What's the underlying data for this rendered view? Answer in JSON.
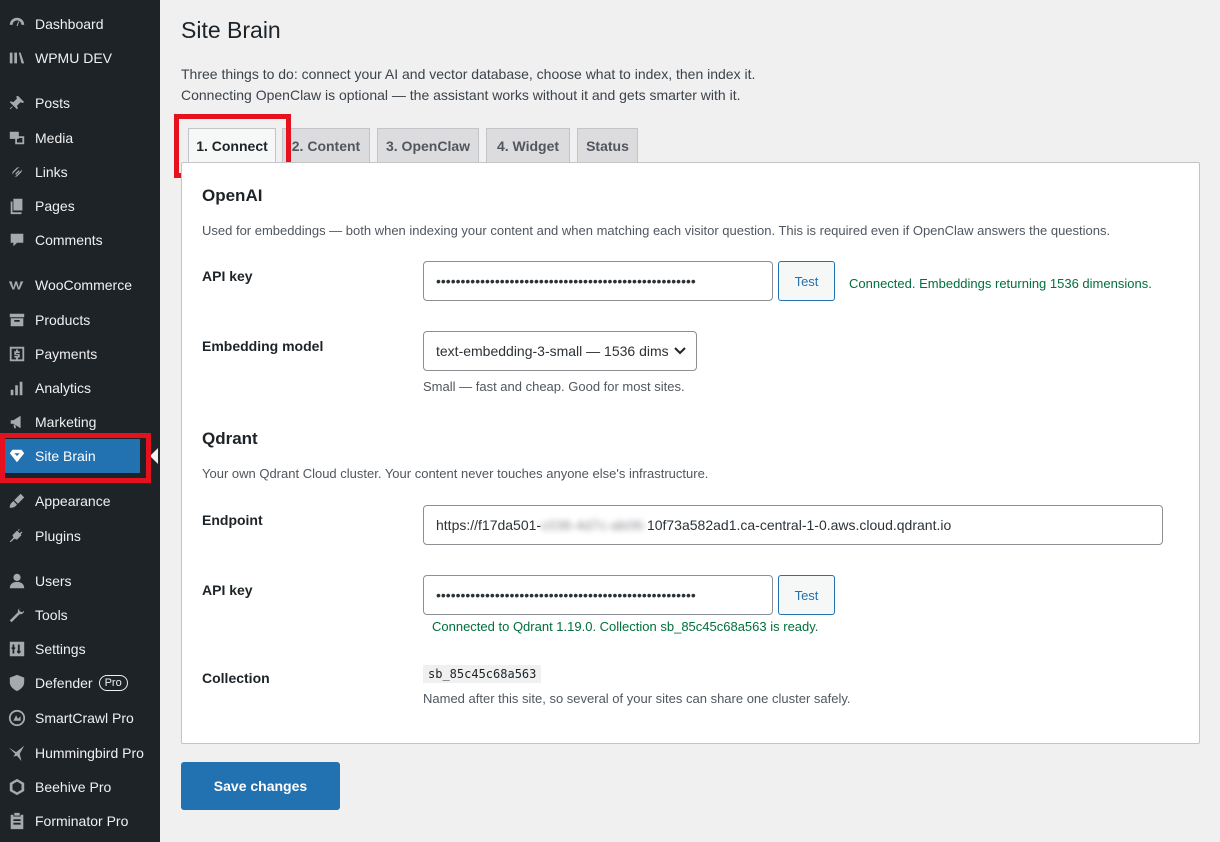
{
  "sidebar": {
    "items": [
      {
        "label": "Dashboard",
        "icon": "dashboard-icon"
      },
      {
        "label": "WPMU DEV",
        "icon": "wpmudev-icon"
      },
      {
        "label": "Posts",
        "icon": "pin-icon"
      },
      {
        "label": "Media",
        "icon": "media-icon"
      },
      {
        "label": "Links",
        "icon": "link-icon"
      },
      {
        "label": "Pages",
        "icon": "pages-icon"
      },
      {
        "label": "Comments",
        "icon": "comment-icon"
      },
      {
        "label": "WooCommerce",
        "icon": "woocommerce-icon"
      },
      {
        "label": "Products",
        "icon": "archive-icon"
      },
      {
        "label": "Payments",
        "icon": "dollar-icon"
      },
      {
        "label": "Analytics",
        "icon": "bar-chart-icon"
      },
      {
        "label": "Marketing",
        "icon": "megaphone-icon"
      },
      {
        "label": "Site Brain",
        "icon": "diamond-icon"
      },
      {
        "label": "Appearance",
        "icon": "brush-icon"
      },
      {
        "label": "Plugins",
        "icon": "plug-icon"
      },
      {
        "label": "Users",
        "icon": "user-icon"
      },
      {
        "label": "Tools",
        "icon": "wrench-icon"
      },
      {
        "label": "Settings",
        "icon": "sliders-icon"
      },
      {
        "label": "Defender",
        "icon": "shield-icon",
        "badge": "Pro"
      },
      {
        "label": "SmartCrawl Pro",
        "icon": "smartcrawl-icon"
      },
      {
        "label": "Hummingbird Pro",
        "icon": "hummingbird-icon"
      },
      {
        "label": "Beehive Pro",
        "icon": "beehive-icon"
      },
      {
        "label": "Forminator Pro",
        "icon": "clipboard-icon"
      }
    ],
    "active": "Site Brain"
  },
  "page": {
    "title": "Site Brain",
    "intro_line1": "Three things to do: connect your AI and vector database, choose what to index, then index it.",
    "intro_line2": "Connecting OpenClaw is optional — the assistant works without it and gets smarter with it."
  },
  "tabs": [
    "1. Connect",
    "2. Content",
    "3. OpenClaw",
    "4. Widget",
    "Status"
  ],
  "active_tab": "1. Connect",
  "openai": {
    "heading": "OpenAI",
    "description": "Used for embeddings — both when indexing your content and when matching each visitor question. This is required even if OpenClaw answers the questions.",
    "api_key_label": "API key",
    "api_key_value": "•••••••••••••••••••••••••••••••••••••••••••••••••••••",
    "test_label": "Test",
    "status": "Connected. Embeddings returning 1536 dimensions.",
    "model_label": "Embedding model",
    "model_value": "text-embedding-3-small — 1536 dims",
    "model_hint": "Small — fast and cheap. Good for most sites."
  },
  "qdrant": {
    "heading": "Qdrant",
    "description": "Your own Qdrant Cloud cluster. Your content never touches anyone else's infrastructure.",
    "endpoint_label": "Endpoint",
    "endpoint_prefix": "https://f17da501-",
    "endpoint_blurred": "c036-4d7c-ab06-",
    "endpoint_suffix": "10f73a582ad1.ca-central-1-0.aws.cloud.qdrant.io",
    "api_key_label": "API key",
    "api_key_value": "•••••••••••••••••••••••••••••••••••••••••••••••••••••",
    "test_label": "Test",
    "status": "Connected to Qdrant 1.19.0. Collection sb_85c45c68a563 is ready.",
    "collection_label": "Collection",
    "collection_value": "sb_85c45c68a563",
    "collection_hint": "Named after this site, so several of your sites can share one cluster safely."
  },
  "save_label": "Save changes",
  "colors": {
    "accent": "#2271b1",
    "success": "#00703c",
    "highlight": "#e5111f",
    "sidebar": "#1d2327"
  }
}
